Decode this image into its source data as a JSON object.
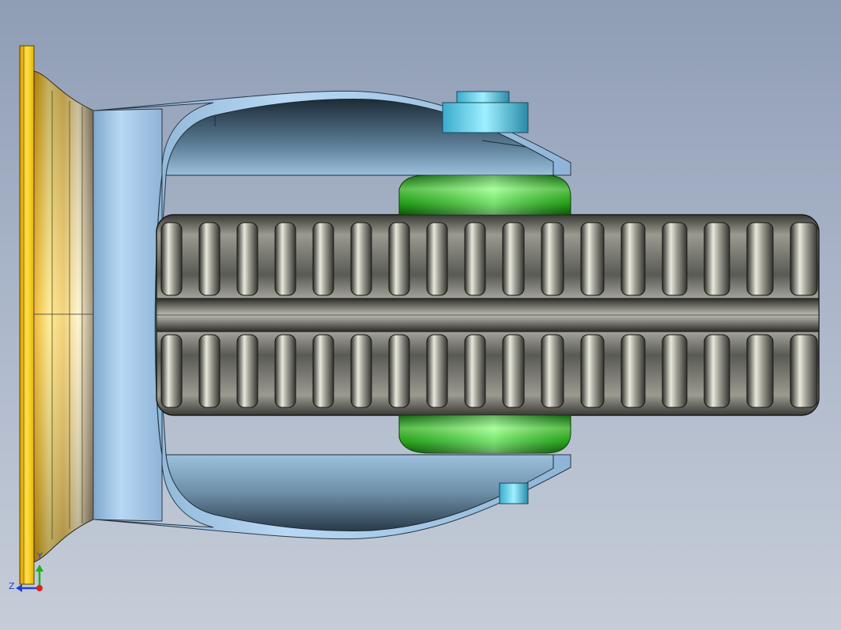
{
  "viewport": {
    "background_top": "#8f9db5",
    "background_bottom": "#c6cdd8"
  },
  "model": {
    "parts": [
      {
        "name": "mounting-plate",
        "color": "#f2c21a"
      },
      {
        "name": "swivel-housing",
        "color": "#f7d97a"
      },
      {
        "name": "fork",
        "color": "#a9cff0"
      },
      {
        "name": "kingpin-nut",
        "color": "#5fd6ea"
      },
      {
        "name": "wheel-hub",
        "color": "#37e12f"
      },
      {
        "name": "tyre",
        "color": "#6f6f68"
      }
    ]
  },
  "triad": {
    "y_axis_label": "Y",
    "z_axis_label": "Z",
    "y_color": "#20b020",
    "z_color": "#2040d0",
    "x_color": "#e02020"
  }
}
